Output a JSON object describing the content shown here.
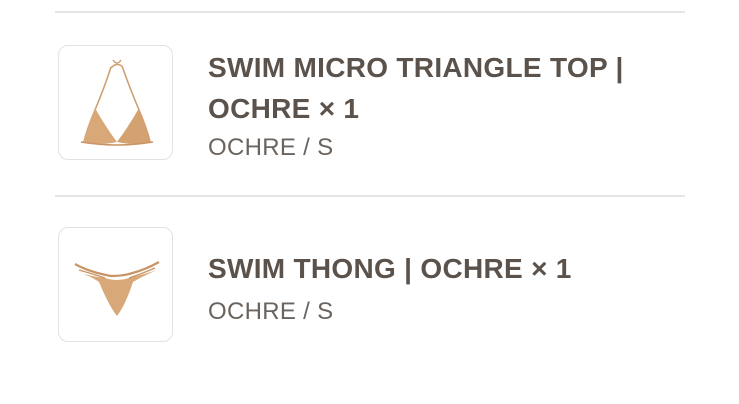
{
  "cart": {
    "items": [
      {
        "title": "SWIM MICRO TRIANGLE TOP | OCHRE × 1",
        "variant": "OCHRE / S",
        "image_icon": "bikini-top-image"
      },
      {
        "title": "SWIM THONG | OCHRE × 1",
        "variant": "OCHRE / S",
        "image_icon": "bikini-bottom-image"
      }
    ]
  },
  "colors": {
    "text": "#5a524b",
    "divider": "#e6e5e3",
    "product": "#d9a878"
  }
}
